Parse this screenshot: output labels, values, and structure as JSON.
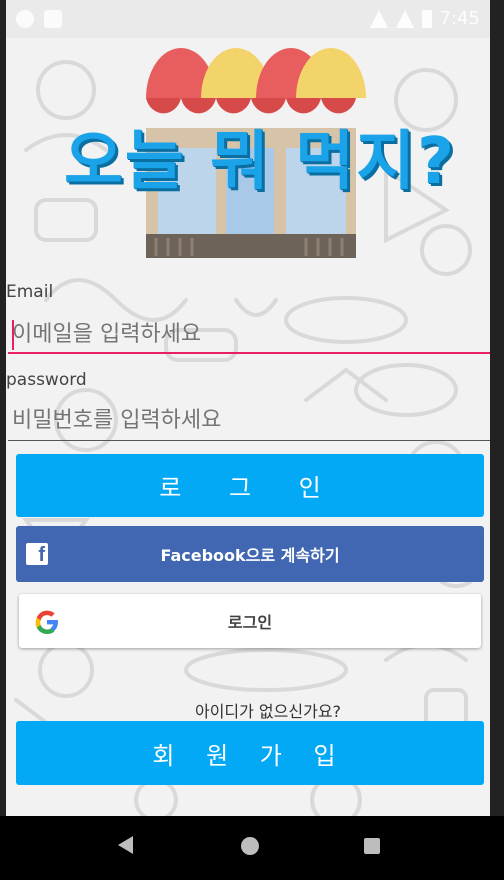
{
  "status_bar": {
    "time": "7:45"
  },
  "app": {
    "title": "오늘 뭐 먹지?"
  },
  "form": {
    "email_label": "Email",
    "email_placeholder": "이메일을 입력하세요",
    "password_label": "password",
    "password_placeholder": "비밀번호를 입력하세요"
  },
  "buttons": {
    "login": "로 그 인",
    "facebook": "Facebook으로 계속하기",
    "google": "로그인",
    "join": "회 원 가 입"
  },
  "no_account_text": "아이디가 없으신가요?",
  "colors": {
    "primary": "#03a9f4",
    "facebook": "#4267b2",
    "focus_line": "#e91e63",
    "title": "#1aa3e8"
  },
  "icons": {
    "facebook": "facebook-f-icon",
    "google": "google-g-icon",
    "nav_back": "back-triangle-icon",
    "nav_home": "home-circle-icon",
    "nav_recent": "recents-square-icon"
  }
}
